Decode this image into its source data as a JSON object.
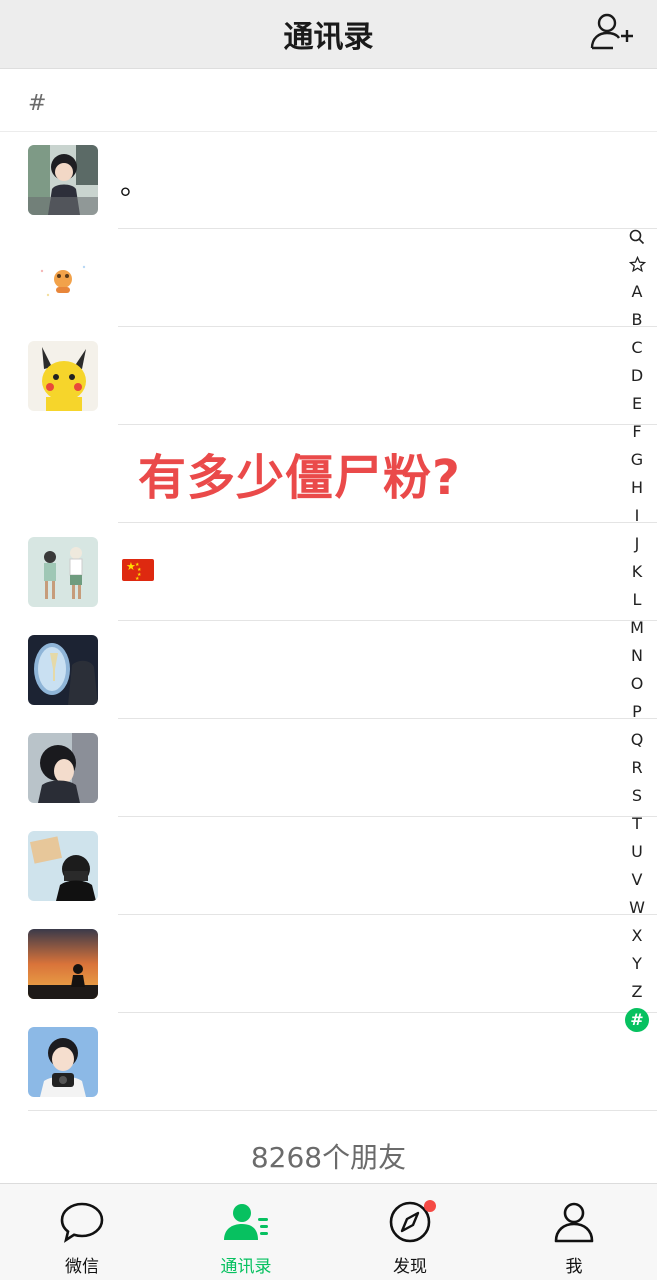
{
  "header": {
    "title": "通讯录",
    "add_icon": "add-contact-icon"
  },
  "section": {
    "letter": "#"
  },
  "contacts": [
    {
      "name": "。"
    },
    {
      "name": ""
    },
    {
      "name": ""
    },
    {
      "name": ""
    },
    {
      "name": "",
      "flag": "china-flag"
    },
    {
      "name": ""
    },
    {
      "name": ""
    },
    {
      "name": ""
    },
    {
      "name": ""
    },
    {
      "name": ""
    }
  ],
  "overlay": {
    "text": "有多少僵尸粉?",
    "color": "#ea4a4a"
  },
  "index_bar": {
    "items": [
      "A",
      "B",
      "C",
      "D",
      "E",
      "F",
      "G",
      "H",
      "I",
      "J",
      "K",
      "L",
      "M",
      "N",
      "O",
      "P",
      "Q",
      "R",
      "S",
      "T",
      "U",
      "V",
      "W",
      "X",
      "Y",
      "Z"
    ],
    "search_icon": "search-icon",
    "star_icon": "star-icon",
    "active": "#"
  },
  "footer": {
    "friend_count": "8268个朋友"
  },
  "tabbar": {
    "tabs": [
      {
        "label": "微信",
        "icon": "chat-bubble-icon"
      },
      {
        "label": "通讯录",
        "icon": "contacts-icon"
      },
      {
        "label": "发现",
        "icon": "compass-icon"
      },
      {
        "label": "我",
        "icon": "person-icon"
      }
    ],
    "accent": "#07c160",
    "badge_color": "#f54a45"
  }
}
